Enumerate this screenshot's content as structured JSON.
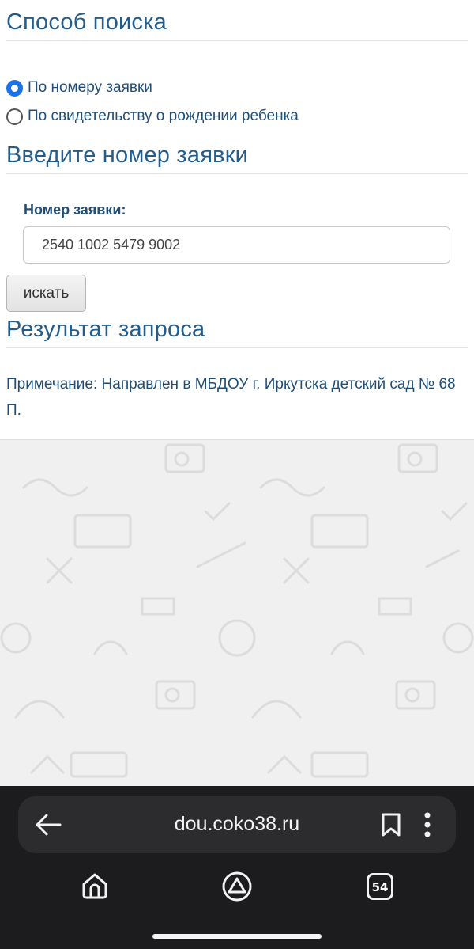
{
  "search_method": {
    "heading": "Способ поиска",
    "options": [
      {
        "label": "По номеру заявки",
        "selected": true
      },
      {
        "label": "По свидетельству о рождении ребенка",
        "selected": false
      }
    ]
  },
  "request_section": {
    "heading": "Введите номер заявки",
    "field_label": "Номер заявки:",
    "field_value": "2540 1002 5479 9002",
    "search_button": "искать"
  },
  "result_section": {
    "heading": "Результат запроса",
    "note": "Примечание: Направлен в МБДОУ г. Иркутска детский сад № 68 П."
  },
  "browser": {
    "url": "dou.coko38.ru",
    "tab_count": "54",
    "icons": [
      "back-arrow-icon",
      "bookmark-icon",
      "more-vert-icon",
      "home-icon",
      "alice-icon",
      "tabs-icon"
    ]
  },
  "colors": {
    "heading": "#245c8a",
    "text": "#1f4e79",
    "radio_accent": "#1a73e8",
    "browser_bar": "#1c1c1e"
  }
}
